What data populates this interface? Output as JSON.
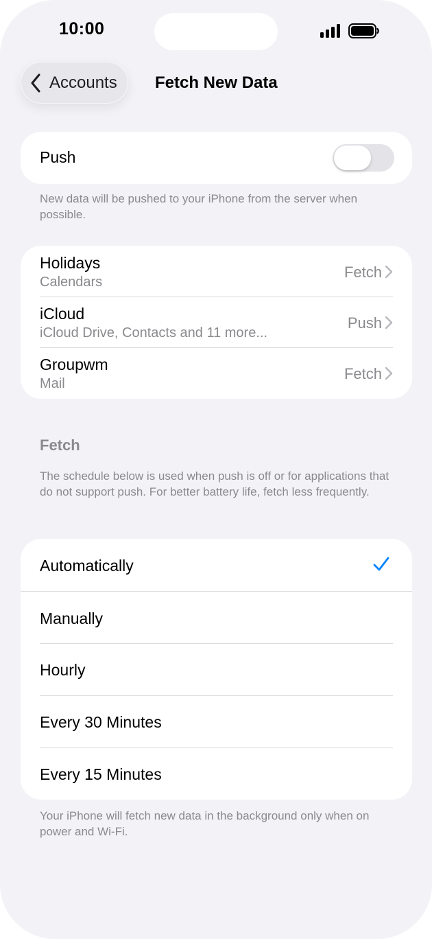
{
  "status_bar": {
    "time": "10:00"
  },
  "nav": {
    "back_label": "Accounts",
    "title": "Fetch New Data"
  },
  "push": {
    "label": "Push",
    "enabled": false,
    "footnote": "New data will be pushed to your iPhone from the server when possible."
  },
  "accounts": [
    {
      "title": "Holidays",
      "subtitle": "Calendars",
      "value": "Fetch"
    },
    {
      "title": "iCloud",
      "subtitle": "iCloud Drive, Contacts and 11 more...",
      "value": "Push"
    },
    {
      "title": "Groupwm",
      "subtitle": "Mail",
      "value": "Fetch"
    }
  ],
  "fetch": {
    "header": "Fetch",
    "description": "The schedule below is used when push is off or for applications that do not support push. For better battery life, fetch less frequently.",
    "options": [
      {
        "label": "Automatically",
        "selected": true
      },
      {
        "label": "Manually",
        "selected": false
      },
      {
        "label": "Hourly",
        "selected": false
      },
      {
        "label": "Every 30 Minutes",
        "selected": false
      },
      {
        "label": "Every 15 Minutes",
        "selected": false
      }
    ],
    "footnote": "Your iPhone will fetch new data in the background only when on power and Wi-Fi."
  },
  "colors": {
    "accent": "#0a84ff",
    "background": "#f2f2f7",
    "secondary_text": "#8a8a8e"
  },
  "icons": {
    "back": "chevron-left-icon",
    "disclosure": "chevron-right-icon",
    "selected": "checkmark-icon",
    "signal": "cellular-signal-icon",
    "battery": "battery-icon"
  }
}
